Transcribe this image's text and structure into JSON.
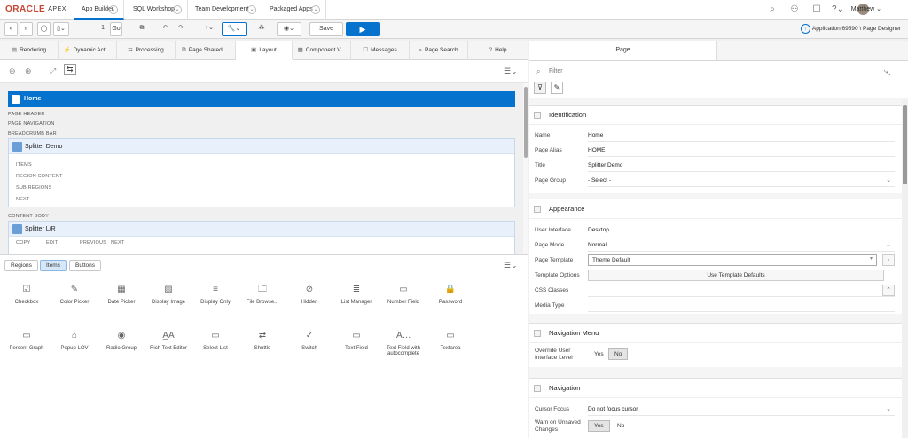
{
  "header": {
    "logo": "ORACLE",
    "logo_sub": "APEX",
    "tabs": [
      {
        "label": "App Builder"
      },
      {
        "label": "SQL Workshop"
      },
      {
        "label": "Team Development"
      },
      {
        "label": "Packaged Apps"
      }
    ],
    "user": "Matthew"
  },
  "toolbar": {
    "page_number": "1",
    "go_label": "Go",
    "save_label": "Save",
    "app_label": "Application 69590",
    "designer_label": "Page Designer"
  },
  "left_tabs": [
    {
      "label": "Rendering"
    },
    {
      "label": "Dynamic Acti..."
    },
    {
      "label": "Processing"
    },
    {
      "label": "Page Shared ..."
    },
    {
      "label": "Layout"
    },
    {
      "label": "Component V..."
    },
    {
      "label": "Messages"
    },
    {
      "label": "Page Search"
    },
    {
      "label": "Help"
    }
  ],
  "layout": {
    "page_title": "Home",
    "slot_page_header": "PAGE HEADER",
    "slot_page_navigation": "PAGE NAVIGATION",
    "slot_breadcrumb": "BREADCRUMB BAR",
    "region1": {
      "title": "Splitter Demo",
      "slots": [
        "ITEMS",
        "REGION CONTENT",
        "SUB REGIONS",
        "NEXT"
      ]
    },
    "slot_content_body": "CONTENT BODY",
    "region2": {
      "title": "Splitter L/R",
      "slots": [
        "COPY",
        "EDIT",
        "PREVIOUS",
        "NEXT"
      ]
    }
  },
  "gallery": {
    "tabs": [
      "Regions",
      "Items",
      "Buttons"
    ],
    "items": [
      "Checkbox",
      "Color Picker",
      "Date Picker",
      "Display Image",
      "Display Only",
      "File Browse...",
      "Hidden",
      "List Manager",
      "Number Field",
      "Password",
      "Percent Graph",
      "Popup LOV",
      "Radio Group",
      "Rich Text Editor",
      "Select List",
      "Shuttle",
      "Switch",
      "Text Field",
      "Text Field with autocomplete",
      "Textarea"
    ]
  },
  "properties": {
    "tab": "Page",
    "filter_placeholder": "Filter",
    "identification": {
      "title": "Identification",
      "name_label": "Name",
      "name_value": "Home",
      "alias_label": "Page Alias",
      "alias_value": "HOME",
      "title_label": "Title",
      "title_value": "Splitter Demo",
      "group_label": "Page Group",
      "group_value": "- Select -"
    },
    "appearance": {
      "title": "Appearance",
      "ui_label": "User Interface",
      "ui_value": "Desktop",
      "mode_label": "Page Mode",
      "mode_value": "Normal",
      "template_label": "Page Template",
      "template_value": "Theme Default",
      "options_label": "Template Options",
      "options_button": "Use Template Defaults",
      "css_label": "CSS Classes",
      "media_label": "Media Type"
    },
    "navmenu": {
      "title": "Navigation Menu",
      "override_label": "Override User Interface Level",
      "yes": "Yes",
      "no": "No"
    },
    "navigation": {
      "title": "Navigation",
      "cursor_label": "Cursor Focus",
      "cursor_value": "Do not focus cursor",
      "warn_label": "Warn on Unsaved Changes",
      "yes": "Yes",
      "no": "No"
    }
  }
}
